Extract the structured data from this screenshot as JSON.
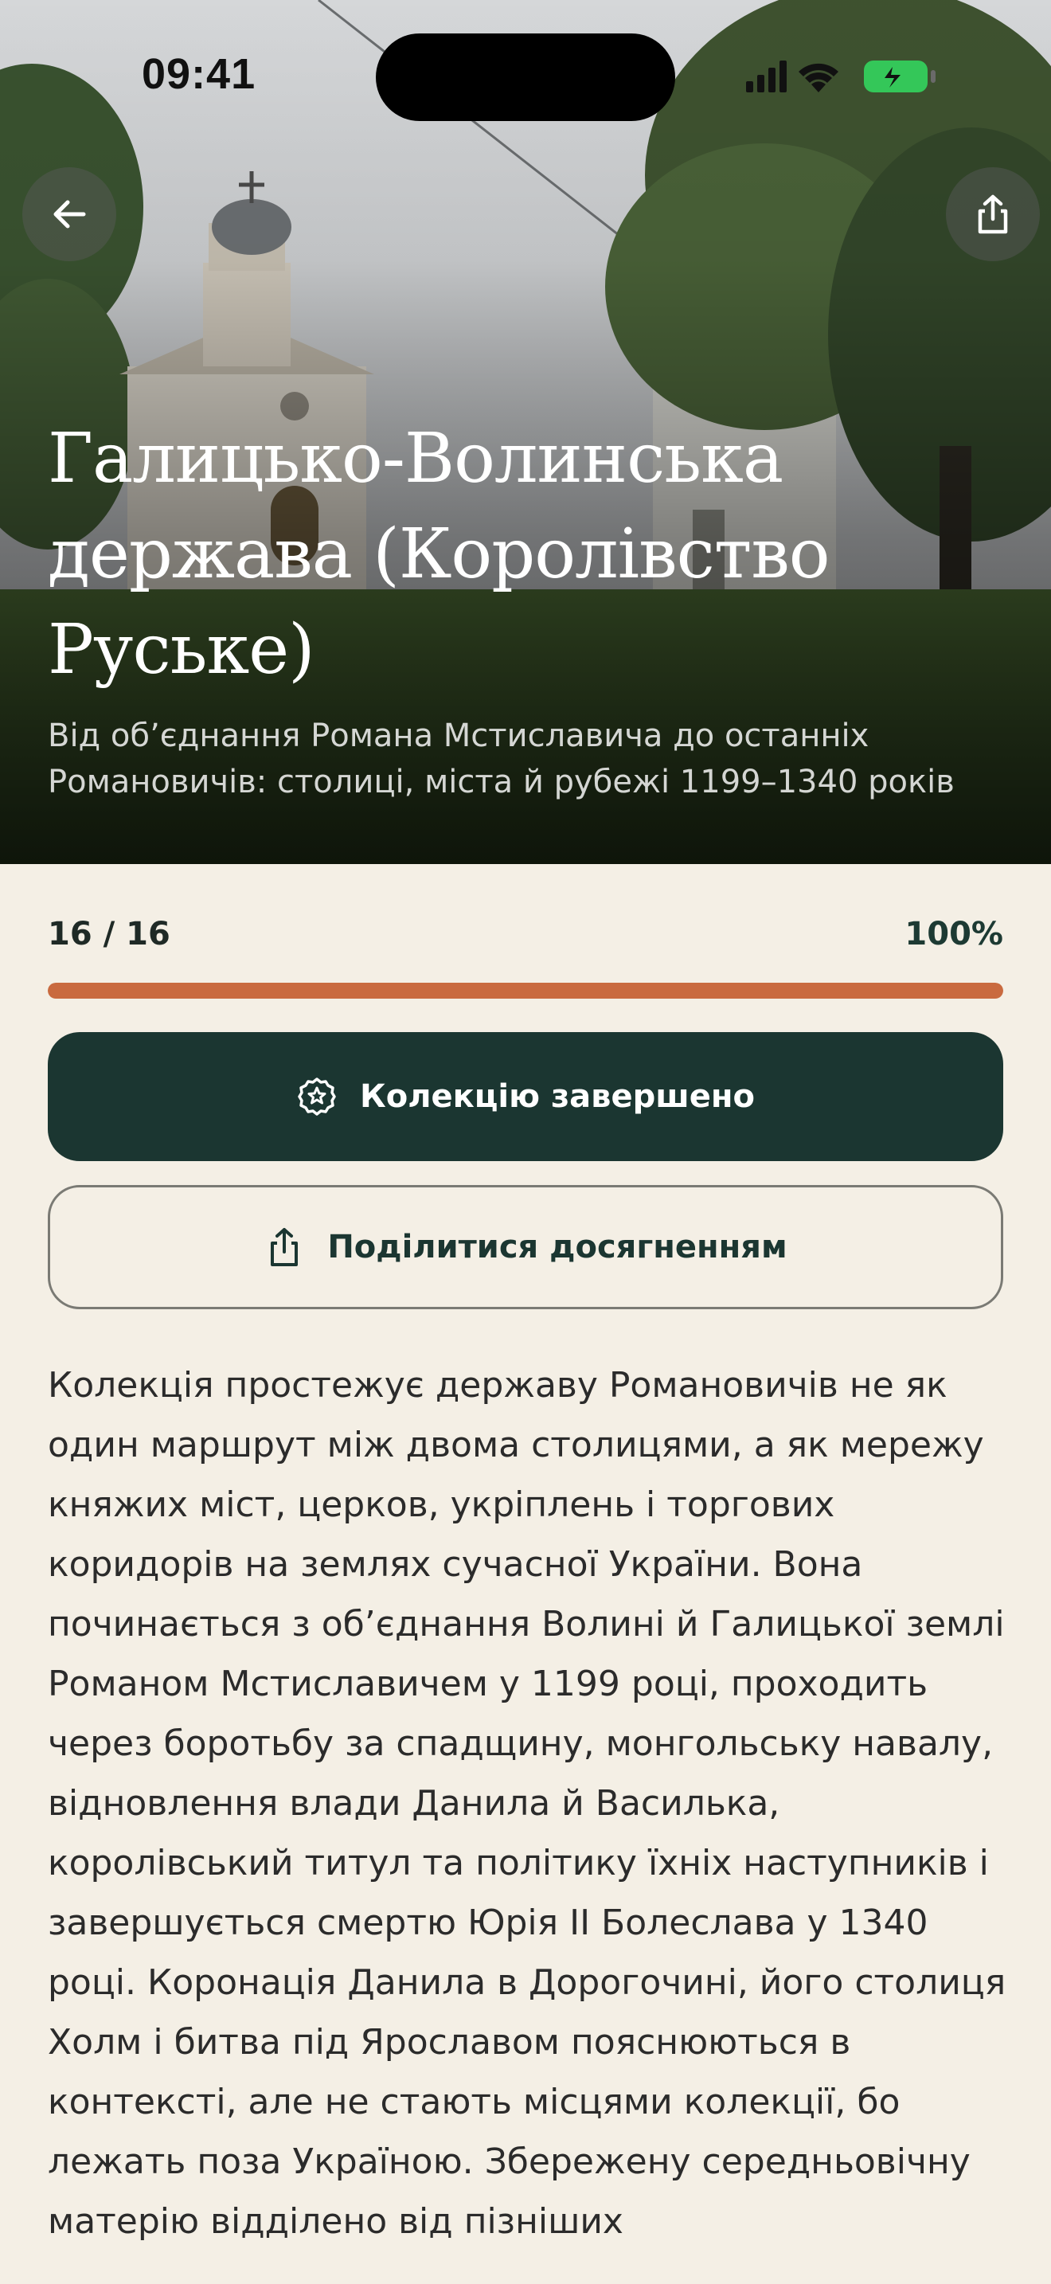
{
  "status_bar": {
    "time": "09:41",
    "icons": [
      "signal-icon",
      "wifi-icon",
      "battery-icon"
    ]
  },
  "header": {
    "back_icon": "arrow-left-icon",
    "share_icon": "share-icon",
    "title": "Галицько-Волинська держава (Королівство Руське)",
    "subtitle": "Від об’єднання Романа Мстиславича до останніх Романовичів: столиці, міста й рубежі 1199–1340 років"
  },
  "progress": {
    "count": "16 / 16",
    "percent_label": "100%",
    "fraction": 1.0
  },
  "actions": {
    "completed_label": "Колекцію завершено",
    "completed_icon": "award-medal-icon",
    "share_label": "Поділитися досягненням",
    "share_icon": "share-icon"
  },
  "description": "Колекція простежує державу Романовичів не як один маршрут між двома столицями, а як мережу княжих міст, церков, укріплень і торгових коридорів на землях сучасної України. Вона починається з об’єднання Волині й Галицької землі Романом Мстиславичем у 1199 році, проходить через боротьбу за спадщину, монгольську навалу, відновлення влади Данила й Василька, королівський титул та політику їхніх наступників і завершується смертю Юрія II Болеслава у 1340 році. Коронація Данила в Дорогочині, його столиця Холм і битва під Ярославом пояснюються в контексті, але не стають місцями колекції, бо лежать поза Україною. Збережену середньовічну матерію відділено від пізніших",
  "colors": {
    "background": "#f4efe5",
    "primary_dark": "#1b3631",
    "accent_progress": "#c96a3f",
    "track": "#e3d8c6",
    "battery_green": "#34c759"
  }
}
